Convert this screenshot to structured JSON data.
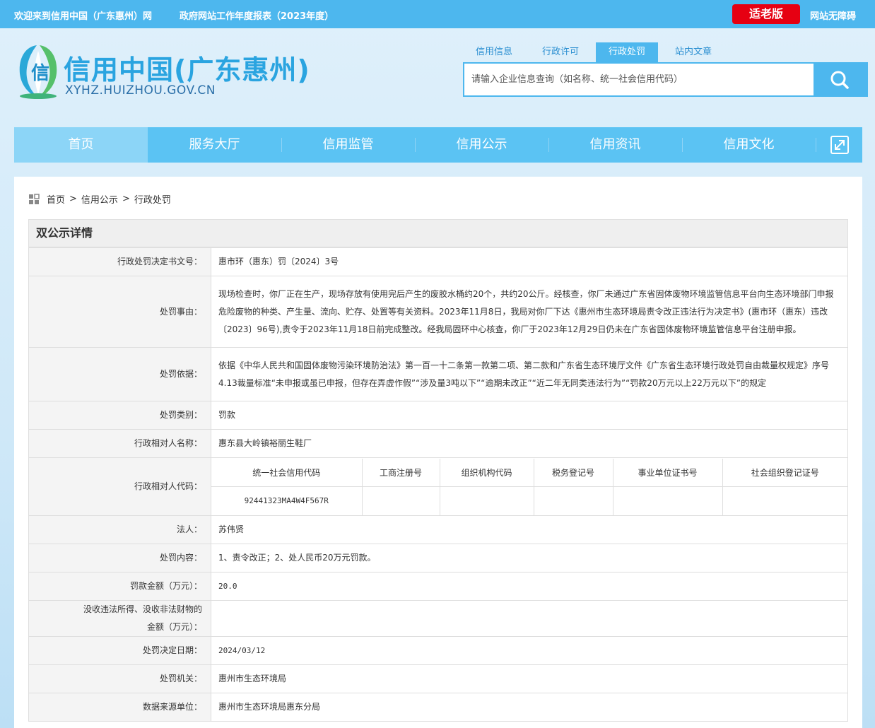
{
  "topbar": {
    "welcome": "欢迎来到信用中国（广东惠州）网",
    "report": "政府网站工作年度报表（2023年度）",
    "elder_mode": "适老版",
    "accessibility": "网站无障碍"
  },
  "logo": {
    "name": "信用中国(广东惠州)",
    "domain": "XYHZ.HUIZHOU.GOV.CN"
  },
  "search": {
    "tabs": [
      "信用信息",
      "行政许可",
      "行政处罚",
      "站内文章"
    ],
    "active_tab": "行政处罚",
    "placeholder": "请输入企业信息查询（如名称、统一社会信用代码）"
  },
  "nav": {
    "items": [
      "首页",
      "服务大厅",
      "信用监管",
      "信用公示",
      "信用资讯",
      "信用文化"
    ]
  },
  "breadcrumb": {
    "home": "首页",
    "sep": ">",
    "level1": "信用公示",
    "level2": "行政处罚"
  },
  "detail": {
    "title": "双公示详情",
    "rows": {
      "decision_no": {
        "label": "行政处罚决定书文号：",
        "value": "惠市环（惠东）罚〔2024〕3号"
      },
      "reason": {
        "label": "处罚事由：",
        "value": "现场检查时，你厂正在生产，现场存放有使用完后产生的废胶水桶约20个，共约20公斤。经核查，你厂未通过广东省固体废物环境监管信息平台向生态环境部门申报危险废物的种类、产生量、流向、贮存、处置等有关资料。2023年11月8日，我局对你厂下达《惠州市生态环境局责令改正违法行为决定书》(惠市环（惠东）违改〔2023〕96号),责令于2023年11月18日前完成整改。经我局固环中心核查，你厂于2023年12月29日仍未在广东省固体废物环境监管信息平台注册申报。"
      },
      "basis": {
        "label": "处罚依据：",
        "value": "依据《中华人民共和国固体废物污染环境防治法》第一百一十二条第一款第二项、第二款和广东省生态环境厅文件《广东省生态环境行政处罚自由裁量权规定》序号4.13裁量标准“未申报或虽已申报，但存在弄虚作假”“涉及量3吨以下”“逾期未改正”“近二年无同类违法行为”“罚款20万元以上22万元以下”的规定"
      },
      "category": {
        "label": "处罚类别：",
        "value": "罚款"
      },
      "party_name": {
        "label": "行政相对人名称：",
        "value": "惠东县大岭镇裕丽生鞋厂"
      },
      "party_code": {
        "label": "行政相对人代码：",
        "headers": [
          "统一社会信用代码",
          "工商注册号",
          "组织机构代码",
          "税务登记号",
          "事业单位证书号",
          "社会组织登记证号"
        ],
        "values": [
          "92441323MA4W4F567R",
          "",
          "",
          "",
          "",
          ""
        ]
      },
      "legal_person": {
        "label": "法人：",
        "value": "苏伟贤"
      },
      "content": {
        "label": "处罚内容：",
        "value": "1、责令改正；2、处人民币20万元罚款。"
      },
      "amount": {
        "label": "罚款金额（万元）：",
        "value": "20.0"
      },
      "confiscation": {
        "label_line1": "没收违法所得、没收非法财物的",
        "label_line2": "金额（万元）：",
        "value": ""
      },
      "decision_date": {
        "label": "处罚决定日期：",
        "value": "2024/03/12"
      },
      "authority": {
        "label": "处罚机关：",
        "value": "惠州市生态环境局"
      },
      "source": {
        "label": "数据来源单位：",
        "value": "惠州市生态环境局惠东分局"
      }
    }
  },
  "colors": {
    "primary": "#4db7ee",
    "nav": "#5bc3f3",
    "nav_active": "#8cd5f7",
    "elder_button": "#e60012"
  },
  "icons": [
    "search-icon",
    "fullscreen-icon",
    "breadcrumb-icon",
    "logo-emblem"
  ]
}
